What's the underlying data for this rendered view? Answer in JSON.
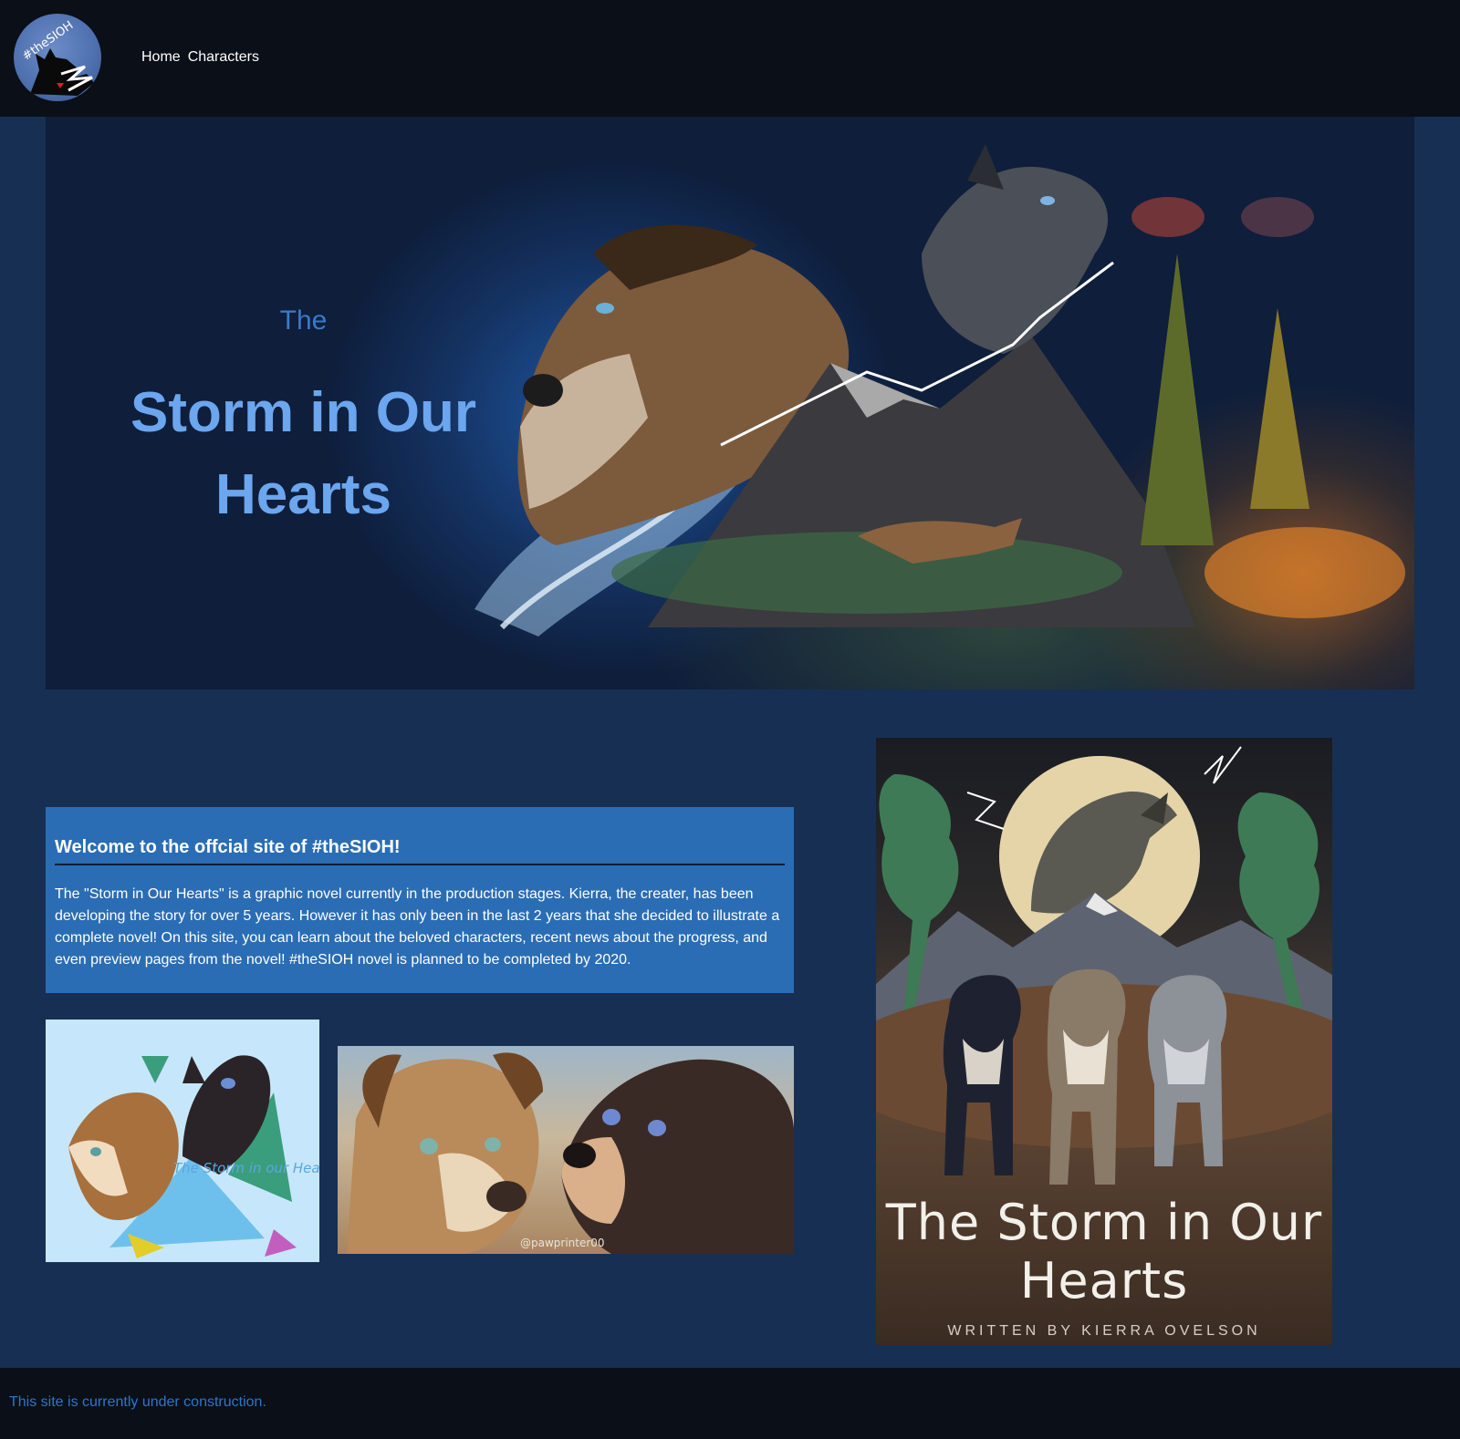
{
  "header": {
    "logo_text": "#theSIOH",
    "nav": [
      {
        "label": "Home"
      },
      {
        "label": "Characters"
      }
    ]
  },
  "hero": {
    "kicker": "The",
    "title": "Storm in Our Hearts"
  },
  "welcome": {
    "heading": "Welcome to the offcial site of #theSIOH!",
    "body": "The \"Storm in Our Hearts\" is a graphic novel currently in the production stages. Kierra, the creater, has been developing the story for over 5 years. However it has only been in the last 2 years that she decided to illustrate a complete novel! On this site, you can learn about the beloved characters, recent news about the progress, and even preview pages from the novel! #theSIOH novel is planned to be completed by 2020."
  },
  "gallery": {
    "thumb1_caption": "The Storm in our Hearts",
    "thumb2_caption": "@pawprinter00"
  },
  "poster": {
    "title": "The Storm in Our Hearts",
    "credit": "WRITTEN BY KIERRA OVELSON"
  },
  "footer": {
    "text": "This site is currently under construction."
  },
  "colors": {
    "header_bg": "#0a0f18",
    "page_bg": "#172f52",
    "welcome_bg": "#2a6db5",
    "hero_title": "#6ba6ee",
    "footer_text": "#2f76c7"
  }
}
